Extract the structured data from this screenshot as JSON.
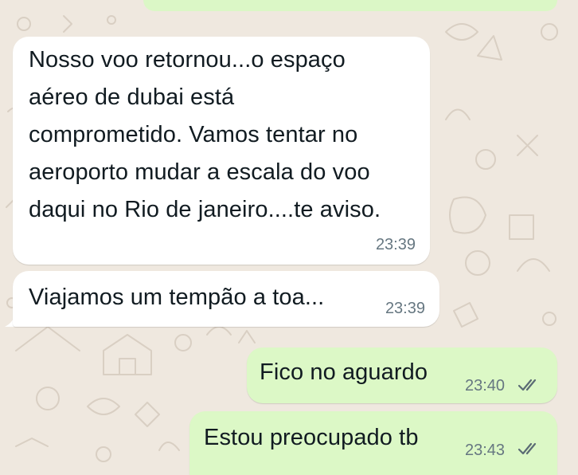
{
  "chat": {
    "messages": [
      {
        "direction": "incoming",
        "lines": [
          "Nosso voo retornou...o espaço",
          "aéreo de dubai está",
          "comprometido.  Vamos tentar no",
          "aeroporto mudar a escala do voo",
          "daqui no Rio de janeiro....te aviso."
        ],
        "time": "23:39"
      },
      {
        "direction": "incoming",
        "text": "Viajamos um tempão a toa...",
        "time": "23:39"
      },
      {
        "direction": "outgoing",
        "text": "Fico no aguardo",
        "time": "23:40",
        "status": "read-ticks-icon"
      },
      {
        "direction": "outgoing",
        "text": "Estou preocupado tb",
        "time": "23:43",
        "status": "read-ticks-icon"
      }
    ]
  },
  "colors": {
    "incoming_bubble": "#ffffff",
    "outgoing_bubble": "#dcf8c6",
    "wallpaper": "#efe8df",
    "timestamp": "#667781",
    "text": "#111b21"
  }
}
